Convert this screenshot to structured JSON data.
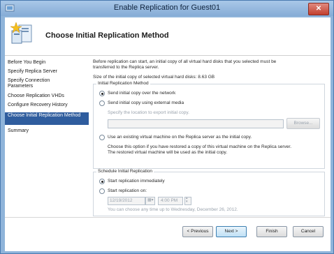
{
  "window": {
    "title": "Enable Replication for Guest01"
  },
  "header": {
    "title": "Choose Initial Replication Method"
  },
  "nav": {
    "items": [
      {
        "label": "Before You Begin"
      },
      {
        "label": "Specify Replica Server"
      },
      {
        "label": "Specify Connection Parameters"
      },
      {
        "label": "Choose Replication VHDs"
      },
      {
        "label": "Configure Recovery History"
      },
      {
        "label": "Choose Initial Replication Method",
        "active": true
      },
      {
        "label": "Summary"
      }
    ]
  },
  "main": {
    "intro_line1": "Before replication can start, an initial copy of all virtual hard disks that you selected must be",
    "intro_line2": "transferred to the Replica server.",
    "size_text": "Size of the initial copy of selected virtual hard disks: 8.63 GB",
    "method_group": {
      "label": "Initial Replication Method",
      "opt_network": "Send initial copy over the network",
      "opt_external": "Send initial copy using external media",
      "location_label": "Specify the location to export initial copy.",
      "location_value": "",
      "browse_label": "Browse...",
      "opt_existing": "Use an existing virtual machine on the Replica server as the initial copy.",
      "existing_desc_line1": "Choose this option if you have restored a copy of this virtual machine on the Replica server.",
      "existing_desc_line2": "The restored virtual machine will be used as the initial copy.",
      "selected": "network"
    },
    "schedule_group": {
      "label": "Schedule Initial Replication",
      "opt_immediate": "Start replication immediately",
      "opt_on": "Start replication on:",
      "date_value": "12/19/2012",
      "time_value": "4:00 PM",
      "hint": "You can choose any time up to Wednesday, December 26, 2012.",
      "selected": "immediate"
    }
  },
  "footer": {
    "previous_label": "< Previous",
    "next_label": "Next >",
    "finish_label": "Finish",
    "cancel_label": "Cancel"
  },
  "colors": {
    "accent": "#2f5d9e",
    "title_bar": "#8fb4da"
  }
}
